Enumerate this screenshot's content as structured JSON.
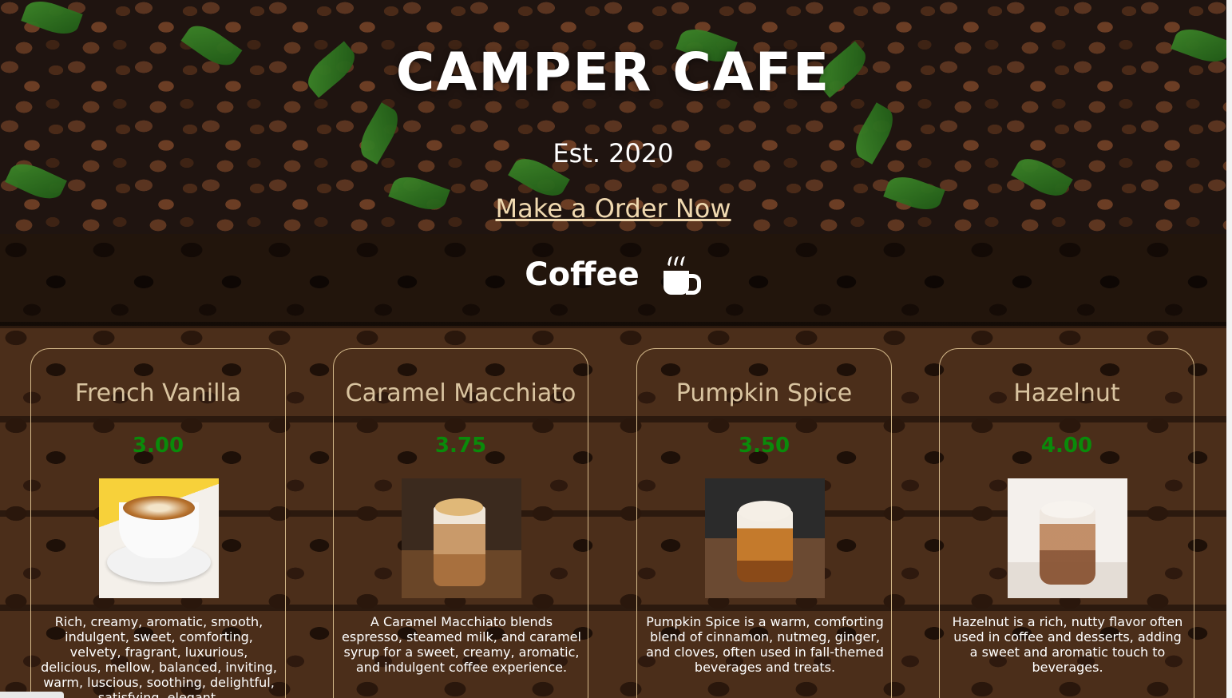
{
  "hero": {
    "title": "CAMPER CAFE",
    "established": "Est. 2020",
    "order_link": "Make a Order Now"
  },
  "section": {
    "title": "Coffee",
    "icon": "coffee-cup-icon"
  },
  "items": [
    {
      "name": "French Vanilla",
      "price": "3.00",
      "description": "Rich, creamy, aromatic, smooth, indulgent, sweet, comforting, velvety, fragrant, luxurious, delicious, mellow, balanced, inviting, warm, luscious, soothing, delightful, satisfying, elegant."
    },
    {
      "name": "Caramel Macchiato",
      "price": "3.75",
      "description": "A Caramel Macchiato blends espresso, steamed milk, and caramel syrup for a sweet, creamy, aromatic, and indulgent coffee experience."
    },
    {
      "name": "Pumpkin Spice",
      "price": "3.50",
      "description": "Pumpkin Spice is a warm, comforting blend of cinnamon, nutmeg, ginger, and cloves, often used in fall-themed beverages and treats."
    },
    {
      "name": "Hazelnut",
      "price": "4.00",
      "description": "Hazelnut is a rich, nutty flavor often used in coffee and desserts, adding a sweet and aromatic touch to beverages."
    }
  ],
  "colors": {
    "price": "#0a8a0a",
    "item_name": "#d9c4a0",
    "card_border": "#d4b98a",
    "link": "#f0d9b0"
  }
}
